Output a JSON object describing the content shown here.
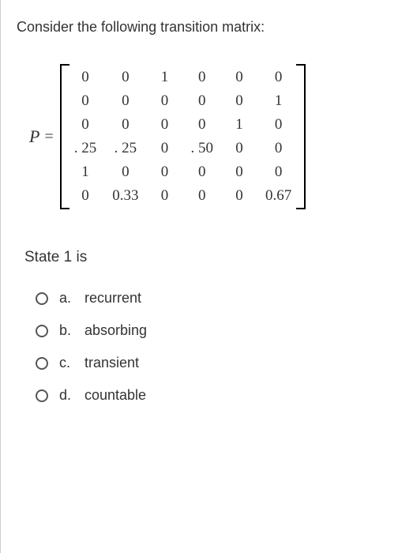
{
  "prompt": "Consider the following transition matrix:",
  "matrix_label": "P",
  "equals": "=",
  "matrix": {
    "rows": 6,
    "cols": 6,
    "values": [
      [
        "0",
        "0",
        "1",
        "0",
        "0",
        "0"
      ],
      [
        "0",
        "0",
        "0",
        "0",
        "0",
        "1"
      ],
      [
        "0",
        "0",
        "0",
        "0",
        "1",
        "0"
      ],
      [
        ". 25",
        ". 25",
        "0",
        ". 50",
        "0",
        "0"
      ],
      [
        "1",
        "0",
        "0",
        "0",
        "0",
        "0"
      ],
      [
        "0",
        "0.33",
        "0",
        "0",
        "0",
        "0.67"
      ]
    ]
  },
  "question": "State 1 is",
  "options": [
    {
      "letter": "a.",
      "text": "recurrent"
    },
    {
      "letter": "b.",
      "text": "absorbing"
    },
    {
      "letter": "c.",
      "text": "transient"
    },
    {
      "letter": "d.",
      "text": "countable"
    }
  ],
  "chart_data": {
    "type": "table",
    "title": "Transition matrix P",
    "rows": [
      [
        0,
        0,
        1,
        0,
        0,
        0
      ],
      [
        0,
        0,
        0,
        0,
        0,
        1
      ],
      [
        0,
        0,
        0,
        0,
        1,
        0
      ],
      [
        0.25,
        0.25,
        0,
        0.5,
        0,
        0
      ],
      [
        1,
        0,
        0,
        0,
        0,
        0
      ],
      [
        0,
        0.33,
        0,
        0,
        0,
        0.67
      ]
    ]
  }
}
